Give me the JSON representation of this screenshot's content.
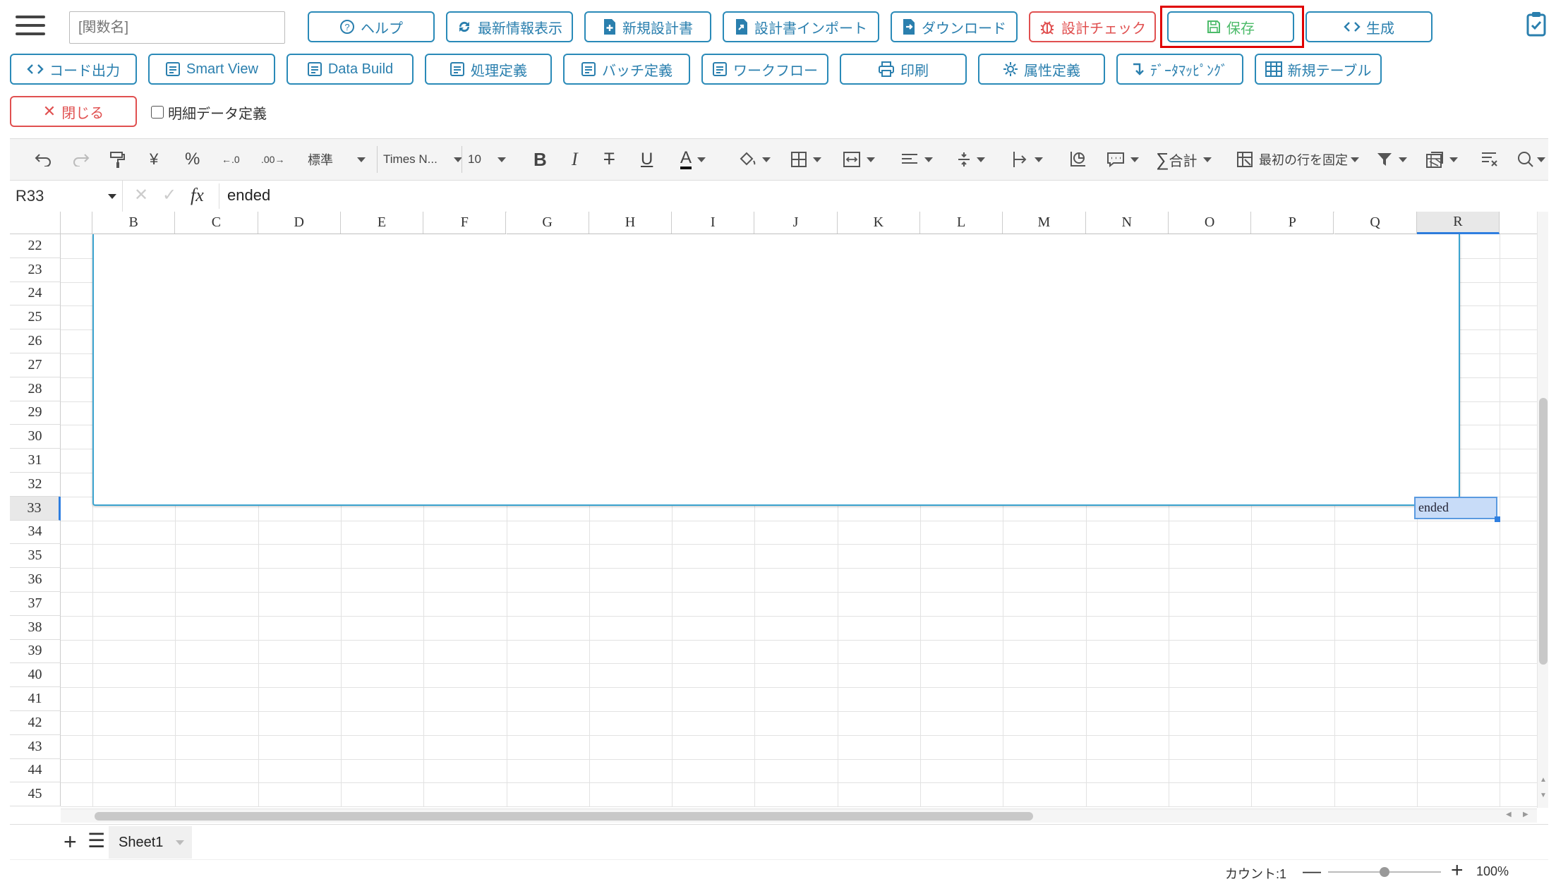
{
  "header": {
    "function_name_placeholder": "[関数名]",
    "row1_buttons": [
      "ヘルプ",
      "最新情報表示",
      "新規設計書",
      "設計書インポート",
      "ダウンロード",
      "設計チェック",
      "保存",
      "生成"
    ],
    "row2_buttons": [
      "コード出力",
      "Smart View",
      "Data Build",
      "処理定義",
      "バッチ定義",
      "ワークフロー",
      "印刷",
      "属性定義",
      "ﾃﾞｰﾀﾏｯﾋﾟﾝｸﾞ",
      "新規テーブル"
    ],
    "close_label": "閉じる",
    "detail_data_label": "明細データ定義"
  },
  "toolbar": {
    "number_format": "標準",
    "font_name": "Times N...",
    "font_size": "10",
    "sum_label": "合計",
    "freeze_label": "最初の行を固定"
  },
  "formula_bar": {
    "cell_ref": "R33",
    "fx": "fx",
    "value": "ended"
  },
  "sheet": {
    "columns": [
      "B",
      "C",
      "D",
      "E",
      "F",
      "G",
      "H",
      "I",
      "J",
      "K",
      "L",
      "M",
      "N",
      "O",
      "P",
      "Q",
      "R"
    ],
    "rows": [
      "22",
      "23",
      "24",
      "25",
      "26",
      "27",
      "28",
      "29",
      "30",
      "31",
      "32",
      "33",
      "34",
      "35",
      "36",
      "37",
      "38",
      "39",
      "40",
      "41",
      "42",
      "43",
      "44",
      "45"
    ],
    "selected_cell_value": "ended",
    "tab_name": "Sheet1"
  },
  "status_bar": {
    "count_label": "カウント:1",
    "zoom": "100%",
    "zoom_fraction": 0.5
  },
  "colors": {
    "accent": "#2a8ab8",
    "danger": "#e05050",
    "save": "#4cbb6a",
    "highlight": "#e00000"
  }
}
